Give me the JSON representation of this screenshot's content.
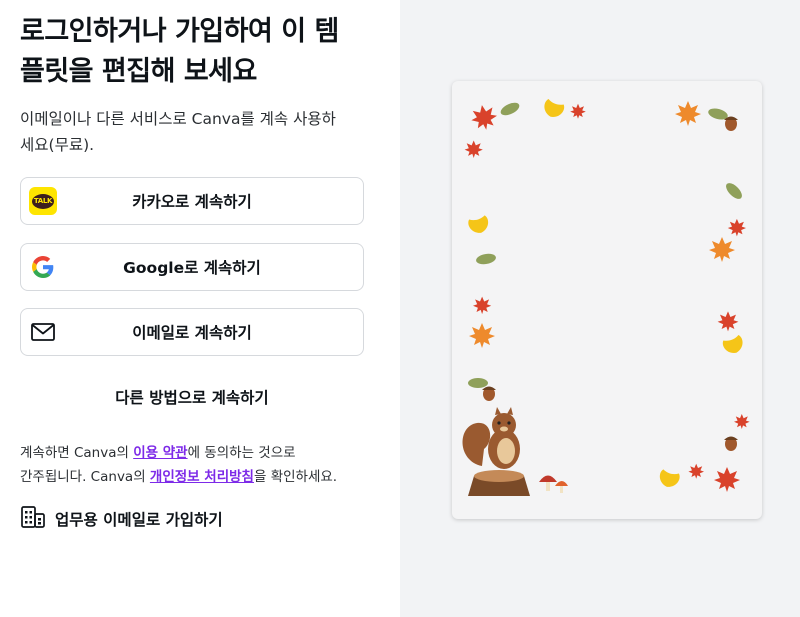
{
  "heading": {
    "line1": "로그인하거나 가입하여 이 템",
    "line2": "플릿을 편집해 보세요"
  },
  "subtitle": {
    "line1": "이메일이나 다른 서비스로 Canva를 계속 사용하",
    "line2": "세요(무료)."
  },
  "buttons": {
    "kakao": "카카오로 계속하기",
    "kakao_icon_text": "TALK",
    "google": "Google로 계속하기",
    "email": "이메일로 계속하기"
  },
  "other_methods": "다른 방법으로 계속하기",
  "terms": {
    "part1": "계속하면 Canva의 ",
    "terms_link": "이용 약관",
    "part2": "에 동의하는 것으로",
    "part3": "간주됩니다. Canva의 ",
    "privacy_link": "개인정보 처리방침",
    "part4": "을 확인하세요."
  },
  "work_signup": "업무용 이메일로 가입하기",
  "colors": {
    "accent_link": "#7d2ae8",
    "kakao_yellow": "#fee500",
    "right_bg": "#f2f3f5",
    "leaf_red": "#d9422b",
    "leaf_orange": "#ee8a2c",
    "ginkgo_yellow": "#f5c518",
    "leaf_green": "#8fa05a"
  },
  "icons": {
    "kakao": "kakao-talk-icon",
    "google": "google-g-icon",
    "email": "envelope-icon",
    "work": "building-icon"
  },
  "preview": {
    "theme": "autumn-leaves-frame-with-squirrel"
  }
}
